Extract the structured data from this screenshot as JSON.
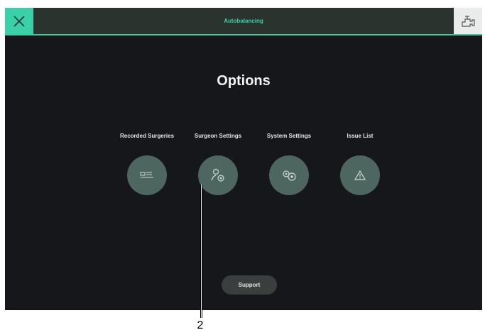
{
  "topbar": {
    "title": "Autobalancing",
    "close_icon": "close-x-icon",
    "right_icon": "device-status-icon",
    "accent_color": "#3ad0a8"
  },
  "main": {
    "title": "Options",
    "options": [
      {
        "label": "Recorded Surgeries",
        "icon": "recorded-surgeries-icon"
      },
      {
        "label": "Surgeon Settings",
        "icon": "surgeon-settings-icon"
      },
      {
        "label": "System Settings",
        "icon": "system-settings-icon"
      },
      {
        "label": "Issue List",
        "icon": "warning-triangle-icon"
      }
    ],
    "support_label": "Support"
  },
  "callout": {
    "number": "2"
  }
}
